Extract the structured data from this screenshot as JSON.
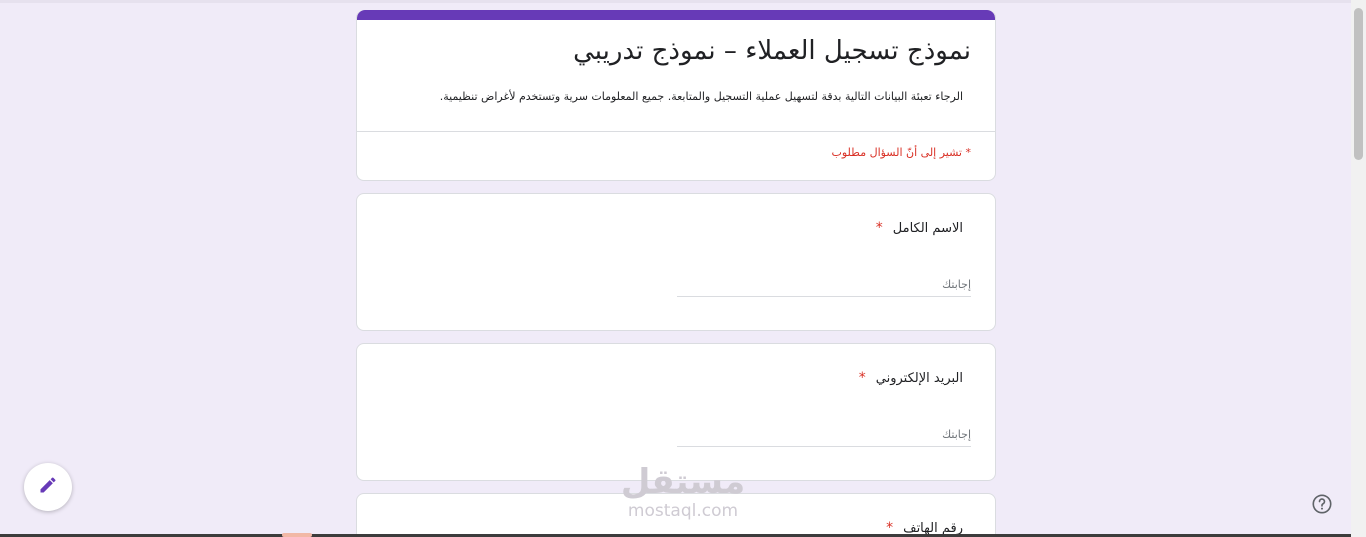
{
  "form": {
    "title": "نموذج تسجيل العملاء – نموذج تدريبي",
    "description": "الرجاء تعبئة البيانات التالية بدقة لتسهيل عملية التسجيل والمتابعة. جميع المعلومات سرية وتستخدم لأغراض تنظيمية.",
    "required_note": "* تشير إلى أنّ السؤال مطلوب",
    "accent_color": "#673ab7",
    "background_color": "#f0ebf8",
    "required_color": "#d93025"
  },
  "questions": [
    {
      "label": "الاسم الكامل",
      "required_mark": "*",
      "placeholder": "إجابتك",
      "value": ""
    },
    {
      "label": "البريد الإلكتروني",
      "required_mark": "*",
      "placeholder": "إجابتك",
      "value": ""
    },
    {
      "label": "رقم الهاتف",
      "required_mark": "*"
    }
  ],
  "watermark": {
    "arabic": "مستقل",
    "latin": "mostaql.com"
  },
  "icons": {
    "edit": "pencil-icon",
    "help": "help-circle-icon"
  }
}
